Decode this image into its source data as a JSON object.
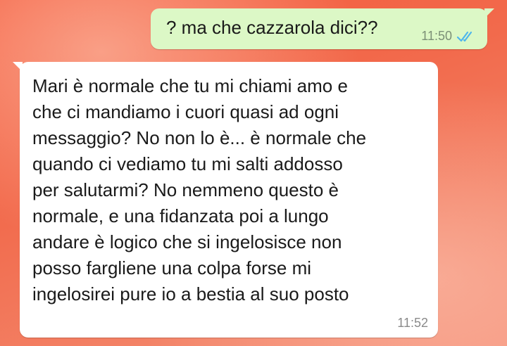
{
  "messages": {
    "outgoing": {
      "text": "? ma che cazzarola dici??",
      "time": "11:50",
      "status_icon": "double-check-read-icon",
      "status_color": "#4fb6ec"
    },
    "incoming": {
      "text": "Mari è normale che tu mi chiami amo e\nche ci mandiamo i cuori quasi ad ogni\nmessaggio? No non lo è... è normale che\nquando ci vediamo tu mi salti addosso\nper salutarmi? No nemmeno questo è\nnormale, e una fidanzata poi a lungo\nandare è logico che si ingelosisce non\nposso fargliene una colpa forse mi\ningelosirei pure io a bestia al suo posto",
      "time": "11:52"
    }
  },
  "colors": {
    "outgoing_bubble": "#dcf8c6",
    "incoming_bubble": "#ffffff",
    "background": "#f26a4c"
  }
}
